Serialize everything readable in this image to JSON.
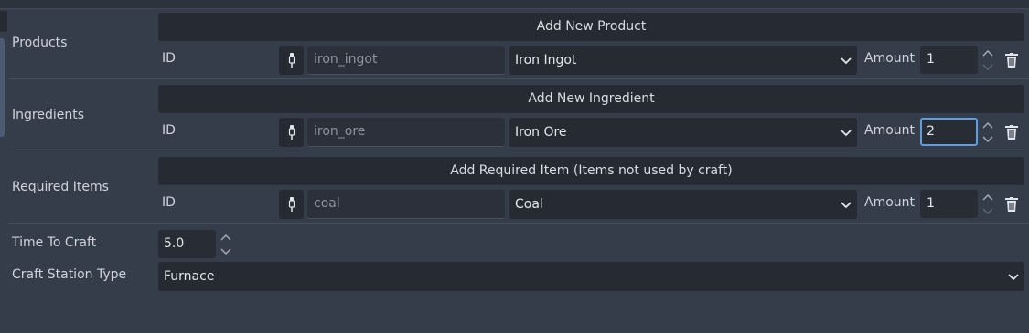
{
  "sections": {
    "products": {
      "label": "Products",
      "add_button": "Add New Product",
      "row": {
        "id_label": "ID",
        "id_value": "iron_ingot",
        "item": "Iron Ingot",
        "amount_label": "Amount",
        "amount": "1"
      }
    },
    "ingredients": {
      "label": "Ingredients",
      "add_button": "Add New Ingredient",
      "row": {
        "id_label": "ID",
        "id_value": "iron_ore",
        "item": "Iron Ore",
        "amount_label": "Amount",
        "amount": "2"
      }
    },
    "required_items": {
      "label": "Required Items",
      "add_button": "Add Required Item (Items not used by craft)",
      "row": {
        "id_label": "ID",
        "id_value": "coal",
        "item": "Coal",
        "amount_label": "Amount",
        "amount": "1"
      }
    }
  },
  "time_to_craft": {
    "label": "Time To Craft",
    "value": "5.0"
  },
  "craft_station_type": {
    "label": "Craft Station Type",
    "value": "Furnace"
  },
  "icons": {
    "pick": "pipette-icon",
    "dropdown": "chevron-down-icon",
    "spin_up": "chevron-up-icon",
    "spin_down": "chevron-down-icon",
    "delete": "trash-icon"
  },
  "colors": {
    "background": "#363d4a",
    "field": "#262b33",
    "focus": "#5a9fe8"
  }
}
